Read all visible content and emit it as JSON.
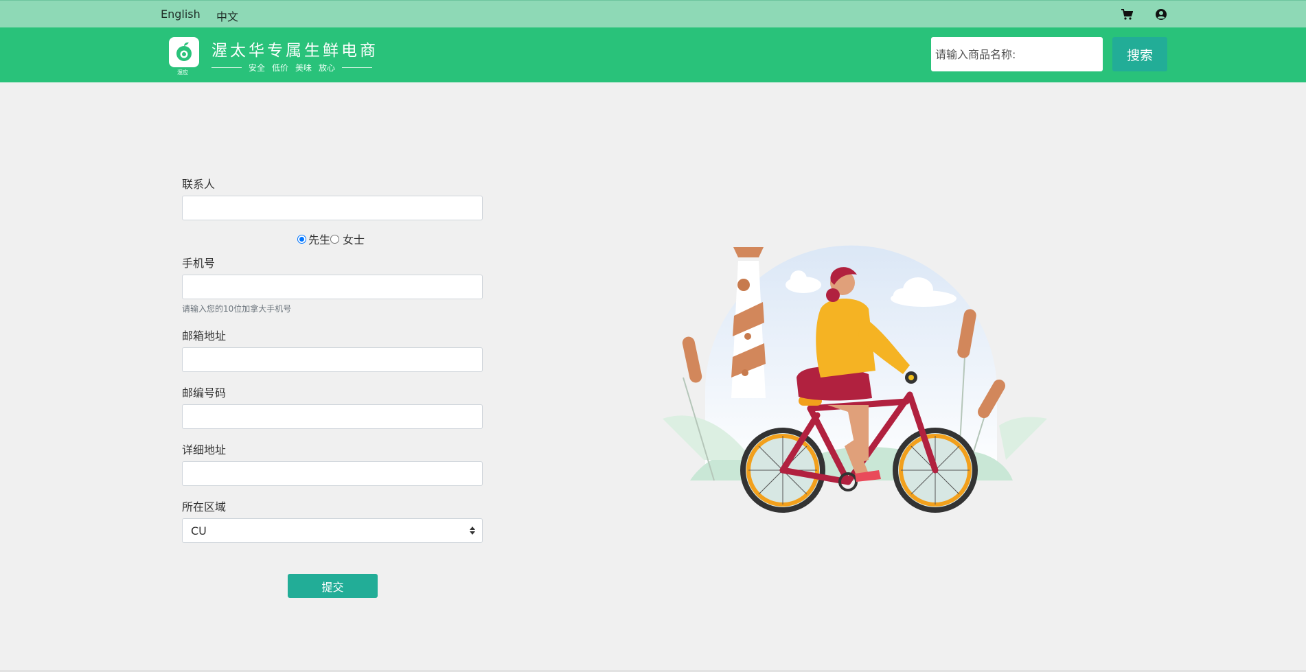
{
  "topbar": {
    "lang_english": "English",
    "lang_chinese": "中文",
    "cart_icon": "cart-icon",
    "user_icon": "user-circle-icon"
  },
  "header": {
    "logo_caption": "渥应",
    "brand_title": "渥太华专属生鲜电商",
    "brand_tags": [
      "安全",
      "低价",
      "美味",
      "放心"
    ],
    "search_placeholder": "请输入商品名称:",
    "search_button": "搜索"
  },
  "form": {
    "contact_label": "联系人",
    "contact_value": "",
    "gender_options": [
      "先生",
      "女士"
    ],
    "gender_selected": "先生",
    "phone_label": "手机号",
    "phone_value": "",
    "phone_hint": "请输入您的10位加拿大手机号",
    "email_label": "邮箱地址",
    "email_value": "",
    "postal_label": "邮编号码",
    "postal_value": "",
    "address_label": "详细地址",
    "address_value": "",
    "region_label": "所在区域",
    "region_selected": "CU",
    "submit_label": "提交"
  },
  "colors": {
    "topbar": "#8ed9b6",
    "header": "#29c27a",
    "button": "#22ad97",
    "background": "#f0f0f0"
  }
}
